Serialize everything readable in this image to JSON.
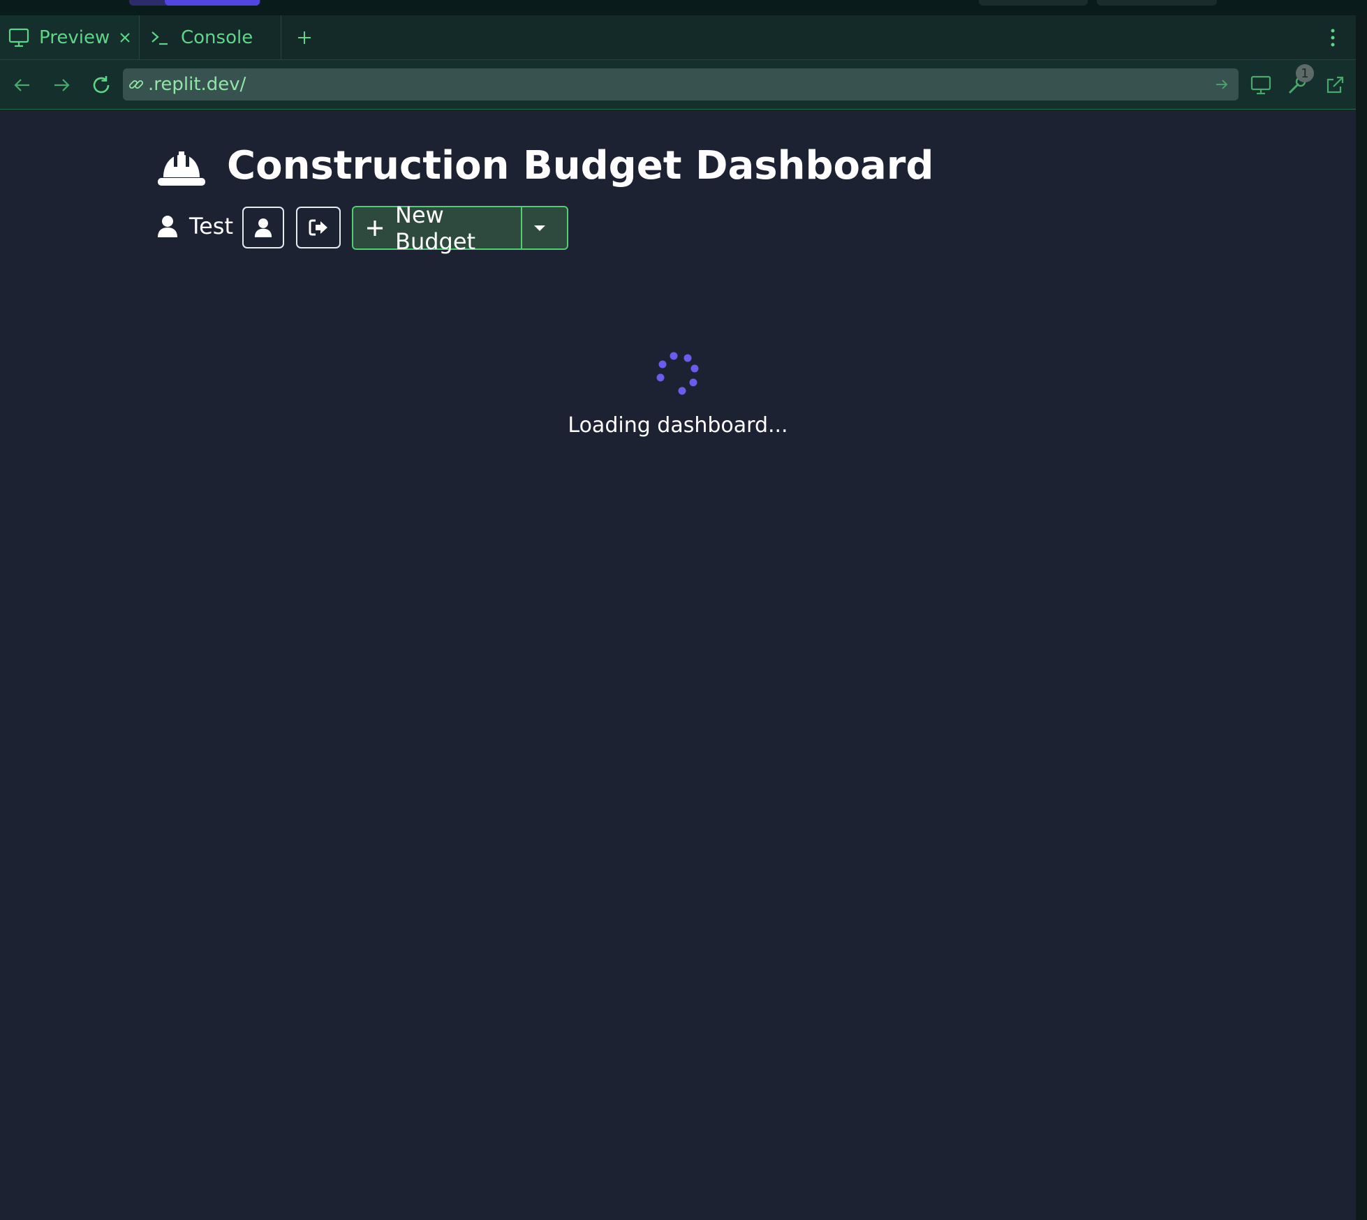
{
  "tabs": {
    "preview_label": "Preview",
    "console_label": "Console"
  },
  "browser": {
    "url": ".replit.dev/",
    "notification_count": "1"
  },
  "page": {
    "title": "Construction Budget Dashboard",
    "user_name": "Test",
    "new_budget_label": "New Budget",
    "loading_text": "Loading dashboard..."
  },
  "colors": {
    "accent_green": "#5fd687",
    "page_background": "#1d2233",
    "spinner": "#6b5cf0"
  },
  "icons": [
    "monitor-icon",
    "close-icon",
    "terminal-icon",
    "plus-icon",
    "kebab-menu-icon",
    "arrow-left-icon",
    "arrow-right-icon",
    "reload-icon",
    "link-icon",
    "go-arrow-icon",
    "devices-icon",
    "wrench-icon",
    "external-link-icon",
    "hard-hat-icon",
    "user-icon",
    "sign-out-icon",
    "caret-down-icon",
    "spinner-icon"
  ]
}
